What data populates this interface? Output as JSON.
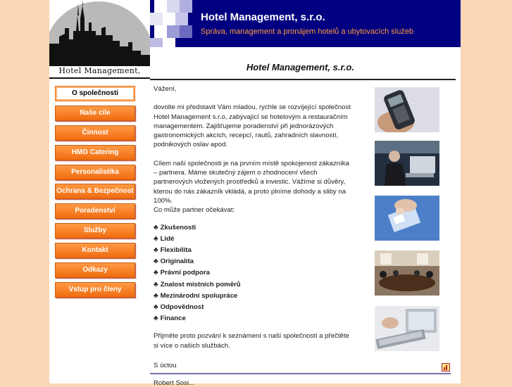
{
  "logo": {
    "caption": "Hotel Management, s.r.o."
  },
  "banner": {
    "title": "Hotel Management, s.r.o.",
    "subtitle": "Správa, management a pronájem hotelů a ubytovacích služeb"
  },
  "page_heading": "Hotel Management, s.r.o.",
  "nav": {
    "items": [
      {
        "label": "O společnosti"
      },
      {
        "label": "Naše cíle"
      },
      {
        "label": "Činnost"
      },
      {
        "label": "HMG Catering"
      },
      {
        "label": "Personalistika"
      },
      {
        "label": "Ochrana & Bezpečnost"
      },
      {
        "label": "Poradenství"
      },
      {
        "label": "Služby"
      },
      {
        "label": "Kontakt"
      },
      {
        "label": "Odkazy"
      },
      {
        "label": "Vstup pro členy"
      }
    ]
  },
  "content": {
    "greeting": "Vážení,",
    "para1": "dovolte mi představit Vám mladou, rychle se rozvíjející společnost Hotel Management s.r.o, zabývající se hotelovým a restauračním managementem. Zajišťujeme poradenství při jednorázových gastronomických akcích, recepcí, rautů, zahradních slavností, podnikových oslav apod.",
    "para2": "Cílem naší společnosti je na prvním místě spokojenost zákazníka – partnera. Máme skutečný zájem o zhodnocení všech partnerových vložených prostředků a investic. Vážíme si důvěry, kterou do nás zákazník vkládá, a proto plníme dohody a sliby na 100%.",
    "intro": "Co může partner očekávat:",
    "bullet": "♣",
    "features": [
      "Zkušenosti",
      "Lidé",
      "Flexibilita",
      "Originalita",
      "Právní podpora",
      "Znalost místních poměrů",
      "Mezinárodní spolupráce",
      "Odpovědnost",
      "Finance"
    ],
    "closing": "Přijměte proto pozvání k seznámení s naší společností a přečtěte si více o našich službách.",
    "signoff": "S úctou",
    "signature": "Robert Sosi..."
  },
  "photos": [
    "phone-photo",
    "office-worker-photo",
    "keyboard-photo",
    "meeting-room-photo",
    "computer-photo"
  ],
  "colors": {
    "background": "#fbd7b5",
    "banner": "#000080",
    "accent": "#f07010",
    "subtitle": "#ff9b3a"
  }
}
